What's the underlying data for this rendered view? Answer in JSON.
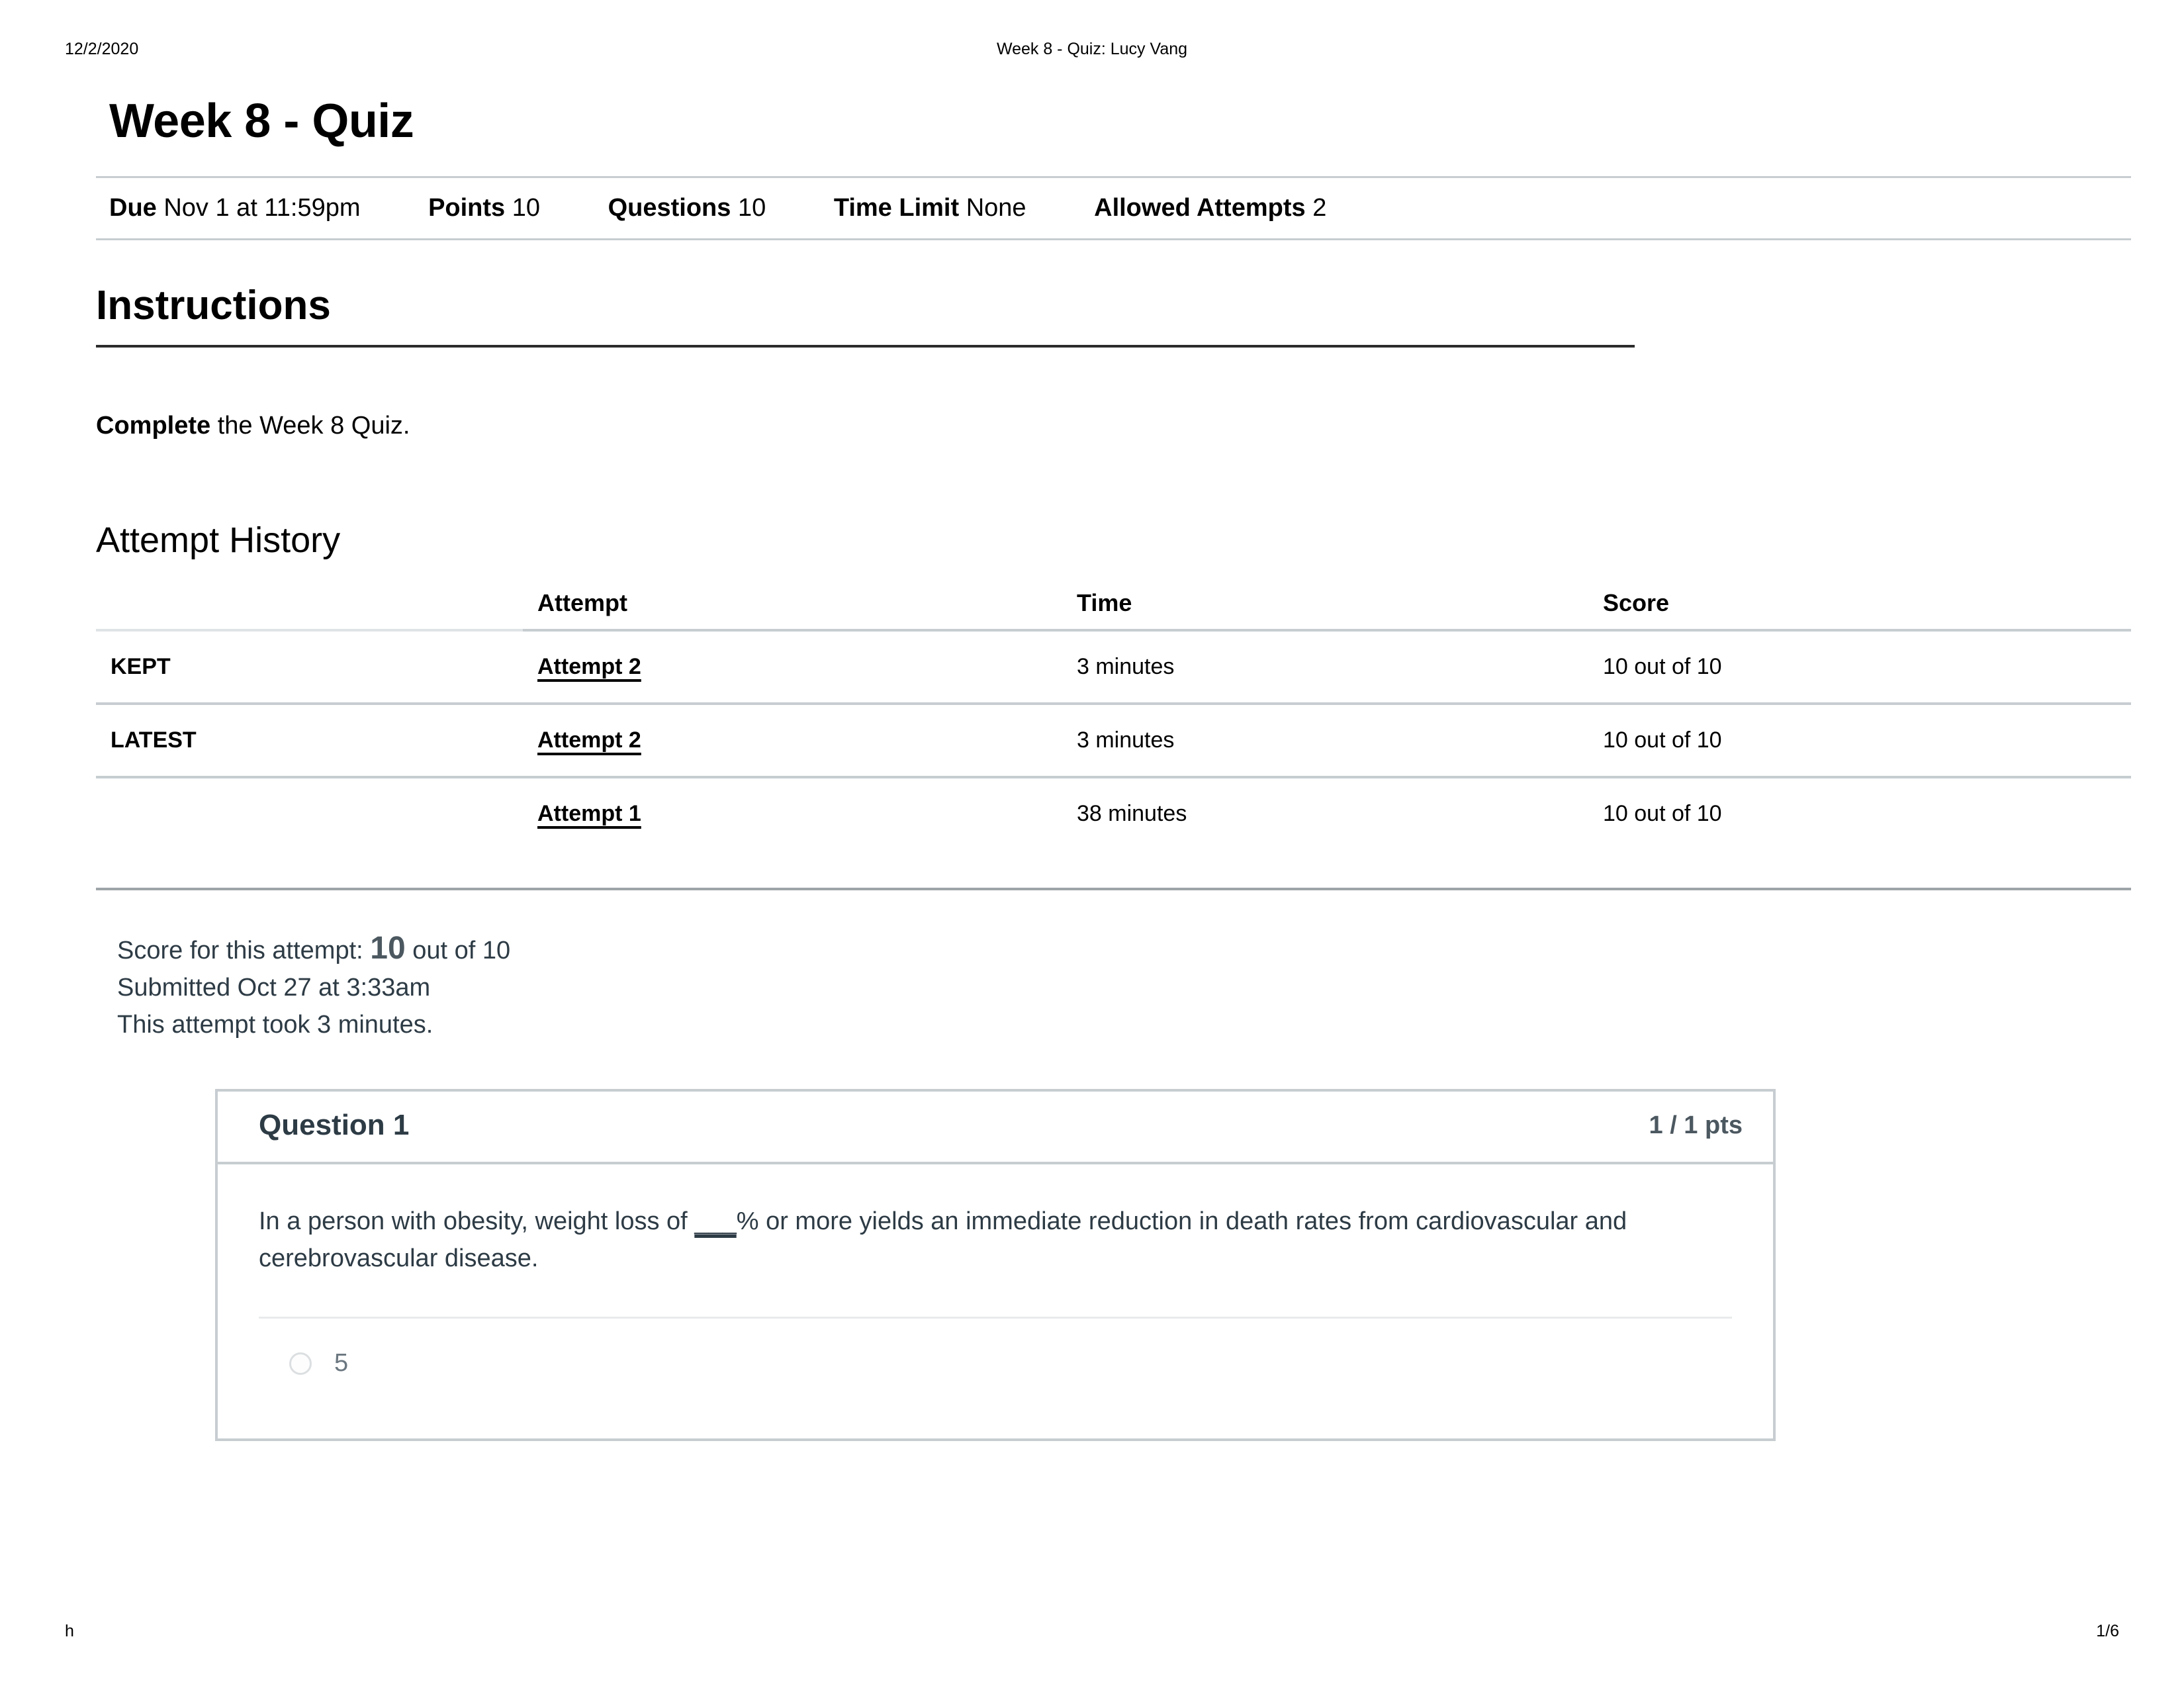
{
  "print": {
    "date": "12/2/2020",
    "doc_title": "Week 8 - Quiz: Lucy Vang",
    "footer_left": "h",
    "page_number": "1/6"
  },
  "quiz": {
    "title": "Week 8 - Quiz",
    "meta": [
      {
        "label": "Due",
        "value": "Nov 1 at 11:59pm"
      },
      {
        "label": "Points",
        "value": "10"
      },
      {
        "label": "Questions",
        "value": "10"
      },
      {
        "label": "Time Limit",
        "value": "None"
      },
      {
        "label": "Allowed Attempts",
        "value": "2"
      }
    ]
  },
  "instructions": {
    "heading": "Instructions",
    "lead": "Complete",
    "rest": " the Week 8 Quiz."
  },
  "attempt_history": {
    "heading": "Attempt History",
    "columns": [
      "",
      "Attempt",
      "Time",
      "Score"
    ],
    "rows": [
      {
        "kind": "KEPT",
        "attempt": "Attempt 2",
        "time": "3 minutes",
        "score": "10 out of 10"
      },
      {
        "kind": "LATEST",
        "attempt": "Attempt 2",
        "time": "3 minutes",
        "score": "10 out of 10"
      },
      {
        "kind": "",
        "attempt": "Attempt 1",
        "time": "38 minutes",
        "score": "10 out of 10"
      }
    ]
  },
  "score_summary": {
    "prefix": "Score for this attempt: ",
    "score": "10",
    "suffix": " out of 10",
    "submitted": "Submitted Oct 27 at 3:33am",
    "duration": "This attempt took 3 minutes."
  },
  "question": {
    "name": "Question 1",
    "points": "1 / 1 pts",
    "text_before": "In a person with obesity, weight loss of ",
    "blank": "___",
    "text_after": "% or more yields an immediate reduction in death rates from cardiovascular and cerebrovascular disease.",
    "answers": [
      {
        "label": "5",
        "selected": false
      }
    ]
  },
  "colors": {
    "text": "#2d3b45",
    "muted": "#6b7780",
    "border": "#c7cdd1",
    "rule_dark": "#2b2b2b"
  }
}
